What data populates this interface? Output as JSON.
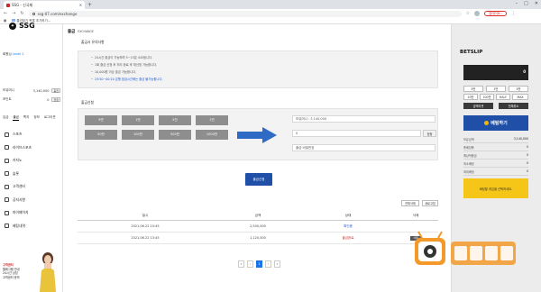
{
  "browser": {
    "tab_title": "SSG - 신국제",
    "url": "ssg-07.com/exchange",
    "update_label": "업데이트 :",
    "bookmark_label": "즐겨찾기 목록 추가하기..."
  },
  "sidebar": {
    "logo": "SSG",
    "user_prefix": "회원님",
    "user_level": "Level 1",
    "balance_label": "보유머니",
    "balance_value": "3,140,000",
    "point_label": "포인트",
    "point_value": "0",
    "btn_charge": "충전",
    "btn_convert": "전환",
    "tabs": [
      "입금",
      "출금",
      "쪽지",
      "정보",
      "로그아웃"
    ],
    "menu": [
      {
        "label": "스포츠",
        "icon": "sports-icon"
      },
      {
        "label": "라이브스포츠",
        "icon": "live-icon"
      },
      {
        "label": "카지노",
        "icon": "casino-icon"
      },
      {
        "label": "슬롯",
        "icon": "slot-icon"
      },
      {
        "label": "고객센터",
        "icon": "support-icon"
      },
      {
        "label": "공지사항",
        "icon": "notice-icon"
      },
      {
        "label": "마이페이지",
        "icon": "user-icon"
      },
      {
        "label": "베팅내역",
        "icon": "history-icon"
      }
    ],
    "cs_title": "고객센터",
    "cs_lines": [
      "텔레그램 안내",
      "24시간 상담",
      "고객센터 문의"
    ]
  },
  "main": {
    "title": "출금",
    "title_sub": "EXCHANGE",
    "notice_label": "출금시 유의사항",
    "notices": [
      "24시간 출금이 가능하며 5~15분 소요됩니다.",
      "1회 출금 신청 후 처리 완료 후 재신청 가능합니다.",
      "10,000원 이상 출금 가능합니다.",
      "23:50~00:10 은행 점검시간에는 출금 불가능합니다."
    ],
    "apply_label": "출금신청",
    "amounts": [
      "5만",
      "1만",
      "5천",
      "1천",
      "50만",
      "100만",
      "500만",
      "1000만"
    ],
    "balance_field": "보유머니 : 3,140,000",
    "amount_value": "0",
    "confirm_label": "정정",
    "password_placeholder": "출금 비밀번호",
    "submit_label": "출금신청",
    "tool_delete_all": "전체삭제",
    "tool_refresh": "새로고침",
    "table": {
      "headers": [
        "일시",
        "금액",
        "상태",
        "삭제"
      ],
      "rows": [
        {
          "date": "2021.06.22 15:45",
          "amount": "2,500,000",
          "status": "확인중",
          "status_color": "blue",
          "delete": ""
        },
        {
          "date": "2021.06.22 13:45",
          "amount": "1,120,000",
          "status": "출금완료",
          "status_color": "red",
          "delete": "삭제"
        }
      ]
    },
    "pager": [
      "«",
      "‹",
      "1",
      "›",
      "»"
    ]
  },
  "betslip": {
    "title": "BETSLIP",
    "display": "0",
    "chips_row1": [
      "5만",
      "1만",
      "5천"
    ],
    "chips_row2": [
      "10만",
      "100만",
      "HALF",
      "MAX"
    ],
    "reset_label": "금액리셋",
    "clear_label": "전체취소",
    "bet_label": "베팅하기",
    "rows": [
      {
        "label": "보유금액",
        "value": "3,140,000"
      },
      {
        "label": "총배당률",
        "value": "0"
      },
      {
        "label": "예상적중금",
        "value": "0"
      },
      {
        "label": "최소베팅",
        "value": "0"
      },
      {
        "label": "최대베팅",
        "value": "0"
      }
    ],
    "empty_msg": "배팅할 게임을 선택하세요."
  }
}
